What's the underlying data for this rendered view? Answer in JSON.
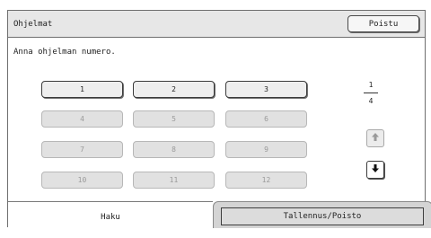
{
  "window": {
    "title": "Ohjelmat",
    "close_label": "Poistu"
  },
  "instruction": "Anna ohjelman numero.",
  "programs": [
    {
      "label": "1",
      "enabled": true
    },
    {
      "label": "2",
      "enabled": true
    },
    {
      "label": "3",
      "enabled": true
    },
    {
      "label": "4",
      "enabled": false
    },
    {
      "label": "5",
      "enabled": false
    },
    {
      "label": "6",
      "enabled": false
    },
    {
      "label": "7",
      "enabled": false
    },
    {
      "label": "8",
      "enabled": false
    },
    {
      "label": "9",
      "enabled": false
    },
    {
      "label": "10",
      "enabled": false
    },
    {
      "label": "11",
      "enabled": false
    },
    {
      "label": "12",
      "enabled": false
    }
  ],
  "pager": {
    "current": "1",
    "total": "4",
    "up_icon": "arrow-up-icon",
    "down_icon": "arrow-down-icon"
  },
  "tabs": {
    "recall": "Haku",
    "store_delete": "Tallennus/Poisto"
  }
}
